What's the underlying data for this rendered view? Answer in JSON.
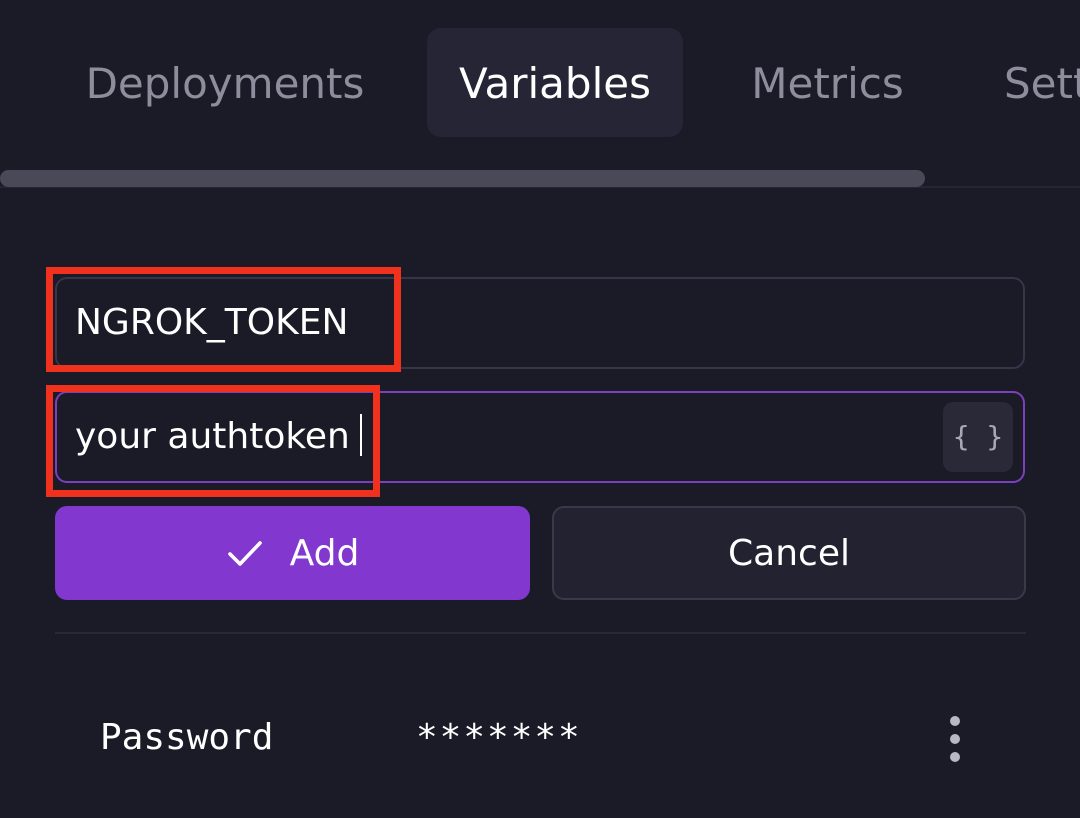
{
  "tabs": [
    {
      "label": "Deployments",
      "active": false
    },
    {
      "label": "Variables",
      "active": true
    },
    {
      "label": "Metrics",
      "active": false
    },
    {
      "label": "Settings",
      "active": false
    }
  ],
  "form": {
    "name_value": "NGROK_TOKEN",
    "value_value": "your authtoken",
    "braces_icon_glyph": "{ }",
    "braces_icon": "braces-icon",
    "add_label": "Add",
    "add_icon": "check-icon",
    "cancel_label": "Cancel"
  },
  "variables": [
    {
      "name": "Password",
      "value": "*******"
    }
  ],
  "colors": {
    "background": "#1b1a27",
    "accent": "#8238cf",
    "highlight": "#f0311e"
  }
}
